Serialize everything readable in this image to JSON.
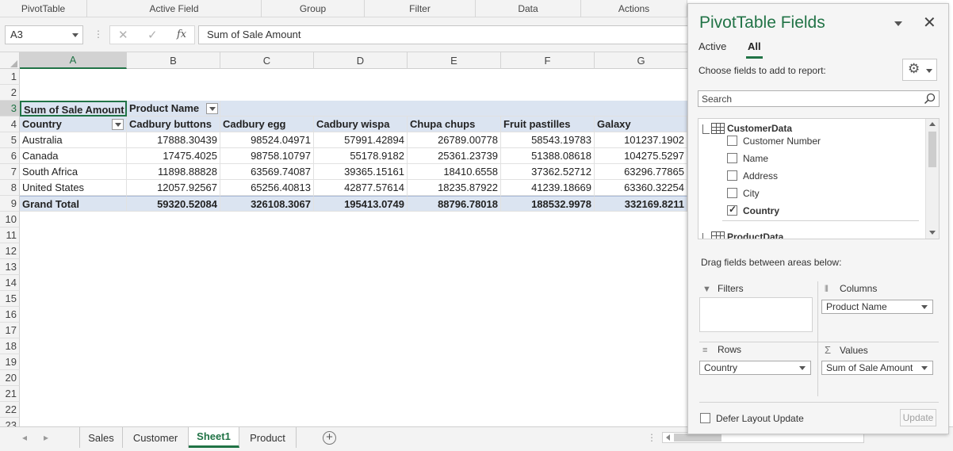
{
  "ribbon": {
    "groups": [
      "PivotTable",
      "Active Field",
      "Group",
      "Filter",
      "Data",
      "Actions"
    ]
  },
  "formula_bar": {
    "name_box": "A3",
    "separator": "⋮",
    "formula": "Sum of Sale Amount",
    "cancel_icon": "✕",
    "enter_icon": "✓",
    "fx_label": "fx"
  },
  "grid": {
    "columns": [
      "A",
      "B",
      "C",
      "D",
      "E",
      "F",
      "G"
    ],
    "row_numbers": [
      "1",
      "2",
      "3",
      "4",
      "5",
      "6",
      "7",
      "8",
      "9",
      "10",
      "11",
      "12",
      "13",
      "14",
      "15",
      "16",
      "17",
      "18",
      "19",
      "20",
      "21",
      "22",
      "23"
    ],
    "pivot": {
      "values_header": "Sum of Sale Amount",
      "columns_header": "Product Name",
      "rows_header": "Country",
      "products": [
        "Cadbury buttons",
        "Cadbury egg",
        "Cadbury wispa",
        "Chupa chups",
        "Fruit pastilles",
        "Galaxy"
      ],
      "rows": [
        {
          "country": "Australia",
          "values": [
            "17888.30439",
            "98524.04971",
            "57991.42894",
            "26789.00778",
            "58543.19783",
            "101237.1902"
          ]
        },
        {
          "country": "Canada",
          "values": [
            "17475.4025",
            "98758.10797",
            "55178.9182",
            "25361.23739",
            "51388.08618",
            "104275.5297"
          ]
        },
        {
          "country": "South Africa",
          "values": [
            "11898.88828",
            "63569.74087",
            "39365.15161",
            "18410.6558",
            "37362.52712",
            "63296.77865"
          ]
        },
        {
          "country": "United States",
          "values": [
            "12057.92567",
            "65256.40813",
            "42877.57614",
            "18235.87922",
            "41239.18669",
            "63360.32254"
          ]
        }
      ],
      "grand_total": {
        "label": "Grand Total",
        "values": [
          "59320.52084",
          "326108.3067",
          "195413.0749",
          "88796.78018",
          "188532.9978",
          "332169.8211"
        ]
      }
    }
  },
  "sheet_tabs": {
    "prev": "◂",
    "next": "▸",
    "tabs": [
      "Sales",
      "Customer",
      "Sheet1",
      "Product"
    ],
    "active": "Sheet1",
    "add_label": "+",
    "dots": "⋮"
  },
  "pane": {
    "title": "PivotTable Fields",
    "close_label": "✕",
    "tabs": [
      "Active",
      "All"
    ],
    "active_tab": "All",
    "choose_label": "Choose fields to add to report:",
    "gear_glyph": "⚙",
    "search_placeholder": "Search",
    "tables": [
      {
        "name": "CustomerData",
        "fields": [
          {
            "name": "Customer Number",
            "checked": false
          },
          {
            "name": "Name",
            "checked": false
          },
          {
            "name": "Address",
            "checked": false
          },
          {
            "name": "City",
            "checked": false
          },
          {
            "name": "Country",
            "checked": true
          }
        ]
      },
      {
        "name": "ProductData",
        "fields": []
      }
    ],
    "drag_label": "Drag fields between areas below:",
    "areas": {
      "filters": {
        "title": "Filters",
        "icon": "▼",
        "items": []
      },
      "columns": {
        "title": "Columns",
        "icon": "⦀",
        "items": [
          "Product Name"
        ]
      },
      "rows": {
        "title": "Rows",
        "icon": "≡",
        "items": [
          "Country"
        ]
      },
      "values": {
        "title": "Values",
        "icon": "Σ",
        "items": [
          "Sum of Sale Amount"
        ]
      }
    },
    "defer_label": "Defer Layout Update",
    "update_label": "Update"
  },
  "colors": {
    "accent": "#217346",
    "pivot_header_fill": "#dbe4f1"
  }
}
